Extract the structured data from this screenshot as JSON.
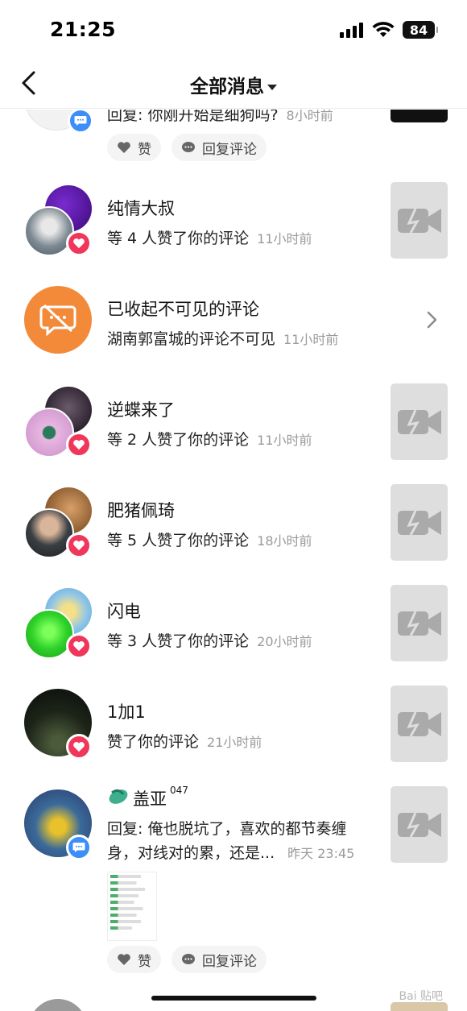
{
  "status_bar": {
    "time": "21:25",
    "battery": "84"
  },
  "nav": {
    "title": "全部消息"
  },
  "top_item": {
    "text": "回复: 你刚开始是细狗吗?",
    "time": "8小时前",
    "like_label": "赞",
    "reply_label": "回复评论"
  },
  "items": [
    {
      "name": "纯情大叔",
      "desc": "等 4 人赞了你的评论",
      "time": "11小时前"
    },
    {
      "name": "已收起不可见的评论",
      "desc": "湖南郭富城的评论不可见",
      "time": "11小时前"
    },
    {
      "name": "逆蝶来了",
      "desc": "等 2 人赞了你的评论",
      "time": "11小时前"
    },
    {
      "name": "肥猪佩琦",
      "desc": "等 5 人赞了你的评论",
      "time": "18小时前"
    },
    {
      "name": "闪电",
      "desc": "等 3 人赞了你的评论",
      "time": "20小时前"
    },
    {
      "name": "1加1",
      "desc": "赞了你的评论",
      "time": "21小时前"
    }
  ],
  "reply_item": {
    "name": "盖亚",
    "superscript": "047",
    "line1": "回复: 俺也脱坑了，喜欢的都节奏缠",
    "line2": "身，对线对的累，还是...",
    "time": "昨天 23:45",
    "like_label": "赞",
    "reply_label": "回复评论"
  },
  "colors": {
    "heart_badge": "#f0365a",
    "comment_badge": "#3d8ef8",
    "hidden_icon": "#f28a3a"
  },
  "watermark": "Bai 贴吧"
}
